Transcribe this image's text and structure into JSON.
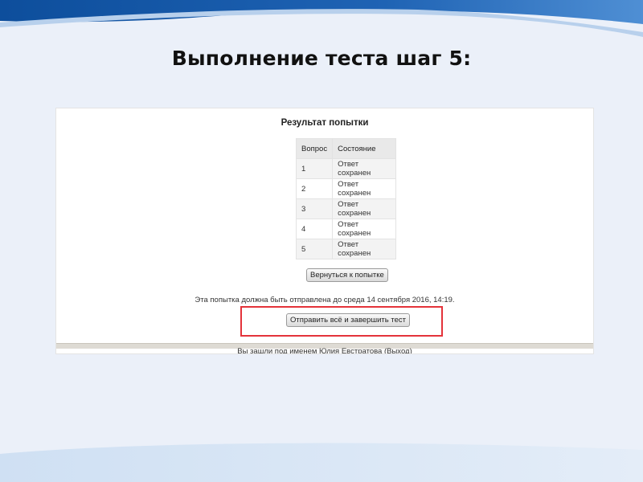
{
  "slide": {
    "title": "Выполнение  теста шаг 5:"
  },
  "colors": {
    "background": "#ebf0f9",
    "accent_blue": "#1a5aa8",
    "highlight_red": "#e4333a"
  },
  "attempt": {
    "heading": "Результат попытки",
    "table": {
      "columns": [
        "Вопрос",
        "Состояние"
      ],
      "rows": [
        {
          "question": "1",
          "state": "Ответ сохранен"
        },
        {
          "question": "2",
          "state": "Ответ сохранен"
        },
        {
          "question": "3",
          "state": "Ответ сохранен"
        },
        {
          "question": "4",
          "state": "Ответ сохранен"
        },
        {
          "question": "5",
          "state": "Ответ сохранен"
        }
      ]
    },
    "back_button": "Вернуться к попытке",
    "due_text": "Эта попытка должна быть отправлена до среда 14 сентября 2016, 14:19.",
    "submit_button": "Отправить всё и завершить тест"
  },
  "footer": {
    "logged_in_prefix": "Вы зашли под именем ",
    "user_name": "Юлия Евстратова",
    "logout_open": " (",
    "logout": "Выход",
    "logout_close": ")"
  }
}
